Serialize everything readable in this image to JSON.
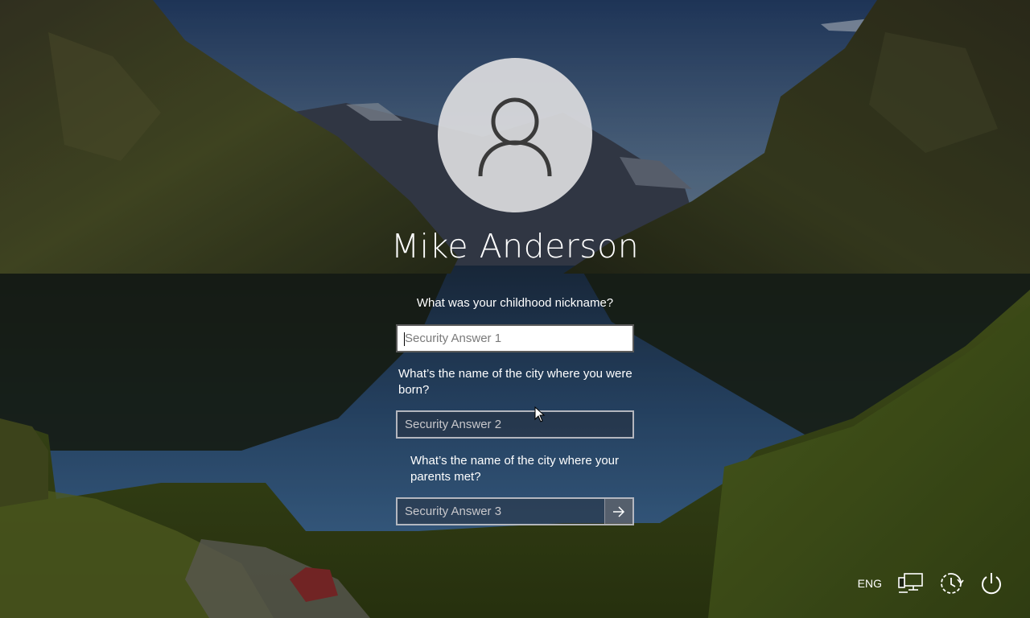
{
  "user": {
    "name": "Mike Anderson"
  },
  "security_questions": [
    {
      "question": "What was your childhood nickname?",
      "answer_placeholder": "Security Answer 1",
      "answer_value": ""
    },
    {
      "question": "What’s the name of the city where you were born?",
      "answer_placeholder": "Security Answer 2",
      "answer_value": ""
    },
    {
      "question": "What’s the name of the city where your parents met?",
      "answer_placeholder": "Security Answer 3",
      "answer_value": ""
    }
  ],
  "tray": {
    "language": "ENG",
    "icons": [
      "network-icon",
      "ease-of-access-icon",
      "power-icon"
    ]
  },
  "icons": {
    "avatar": "user-silhouette-icon",
    "submit": "arrow-right-icon"
  }
}
